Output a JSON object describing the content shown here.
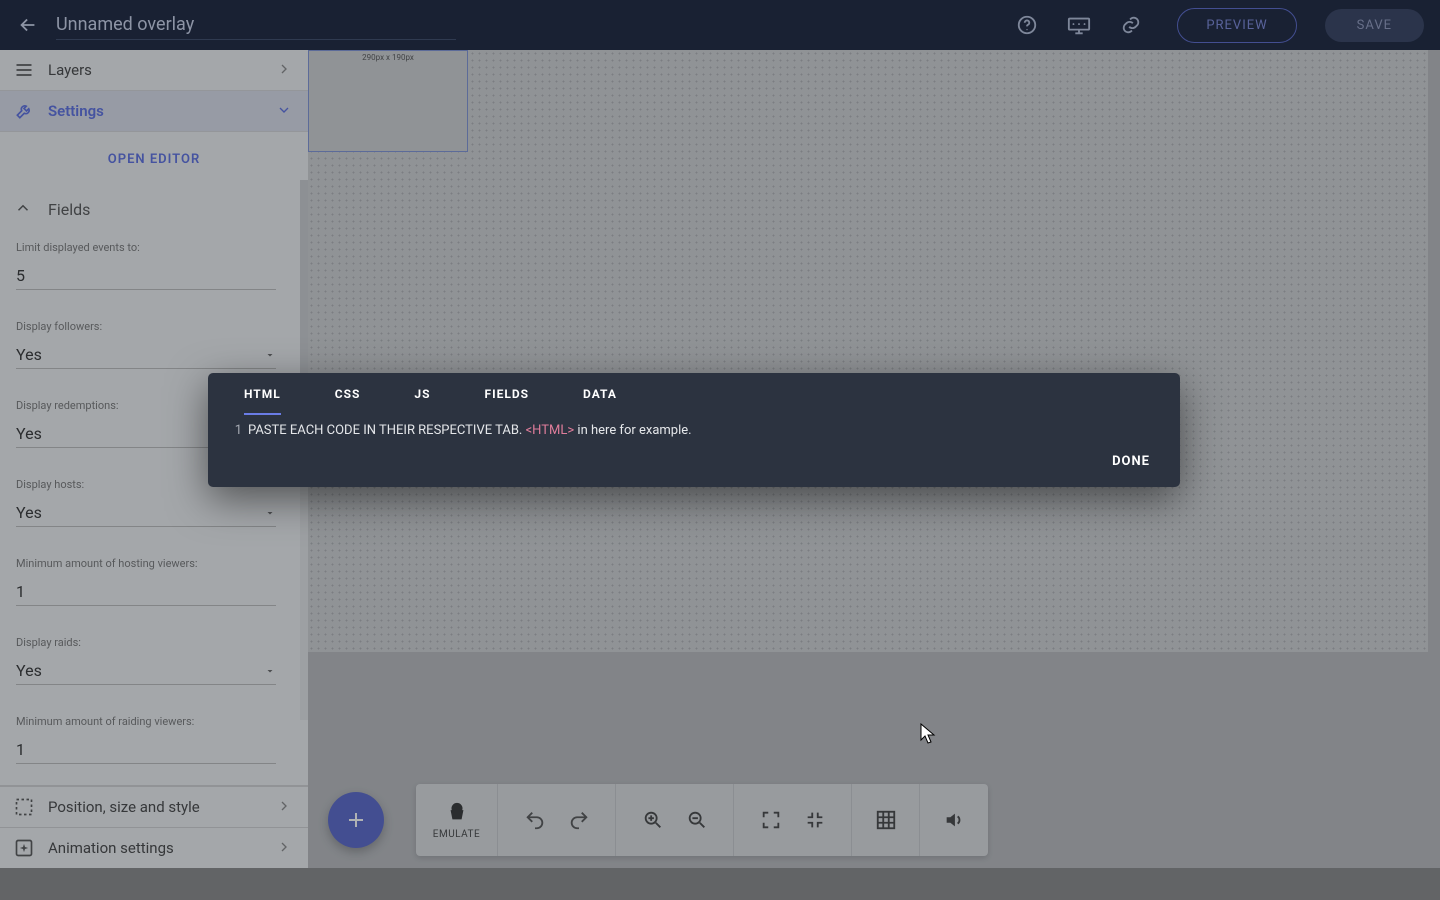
{
  "header": {
    "title": "Unnamed overlay",
    "preview": "PREVIEW",
    "save": "SAVE"
  },
  "sidebar": {
    "layers": "Layers",
    "settings": "Settings",
    "open_editor": "OPEN EDITOR",
    "fields_header": "Fields",
    "fields": {
      "limit": {
        "label": "Limit displayed events to:",
        "value": "5"
      },
      "followers": {
        "label": "Display followers:",
        "value": "Yes"
      },
      "redemptions": {
        "label": "Display redemptions:",
        "value": "Yes"
      },
      "hosts": {
        "label": "Display hosts:",
        "value": "Yes"
      },
      "min_host": {
        "label": "Minimum amount of hosting viewers:",
        "value": "1"
      },
      "raids": {
        "label": "Display raids:",
        "value": "Yes"
      },
      "min_raid": {
        "label": "Minimum amount of raiding viewers:",
        "value": "1"
      }
    },
    "position": "Position, size and style",
    "animation": "Animation settings"
  },
  "canvas": {
    "widget_size": "290px x 190px"
  },
  "toolbar": {
    "emulate": "EMULATE"
  },
  "modal": {
    "tabs": {
      "html": "HTML",
      "css": "CSS",
      "js": "JS",
      "fields": "FIELDS",
      "data": "DATA"
    },
    "line_no": "1",
    "code_pre": "PASTE EACH CODE IN THEIR RESPECTIVE TAB. ",
    "code_tag": "<HTML>",
    "code_post": " in here for example.",
    "done": "DONE"
  }
}
